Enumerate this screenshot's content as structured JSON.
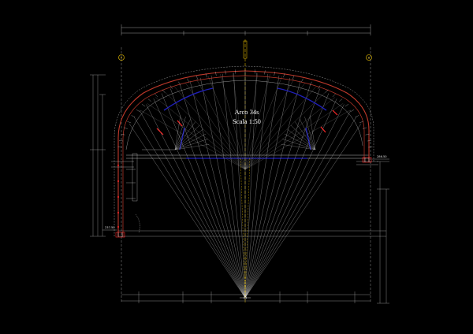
{
  "drawing": {
    "title": "Arco 34s",
    "scale": "Scala 1:50"
  },
  "colors": {
    "background": "#000000",
    "construction_lines": "#cfcfcf",
    "arch_member": "#c0392b",
    "accent_red": "#ff2a2a",
    "axis_yellow": "#ffd200",
    "dimension_lines": "#bfbfbf",
    "grid_blue": "#1f1fb8"
  },
  "levels": {
    "left_base": "237.50",
    "right_base": "286.50"
  }
}
